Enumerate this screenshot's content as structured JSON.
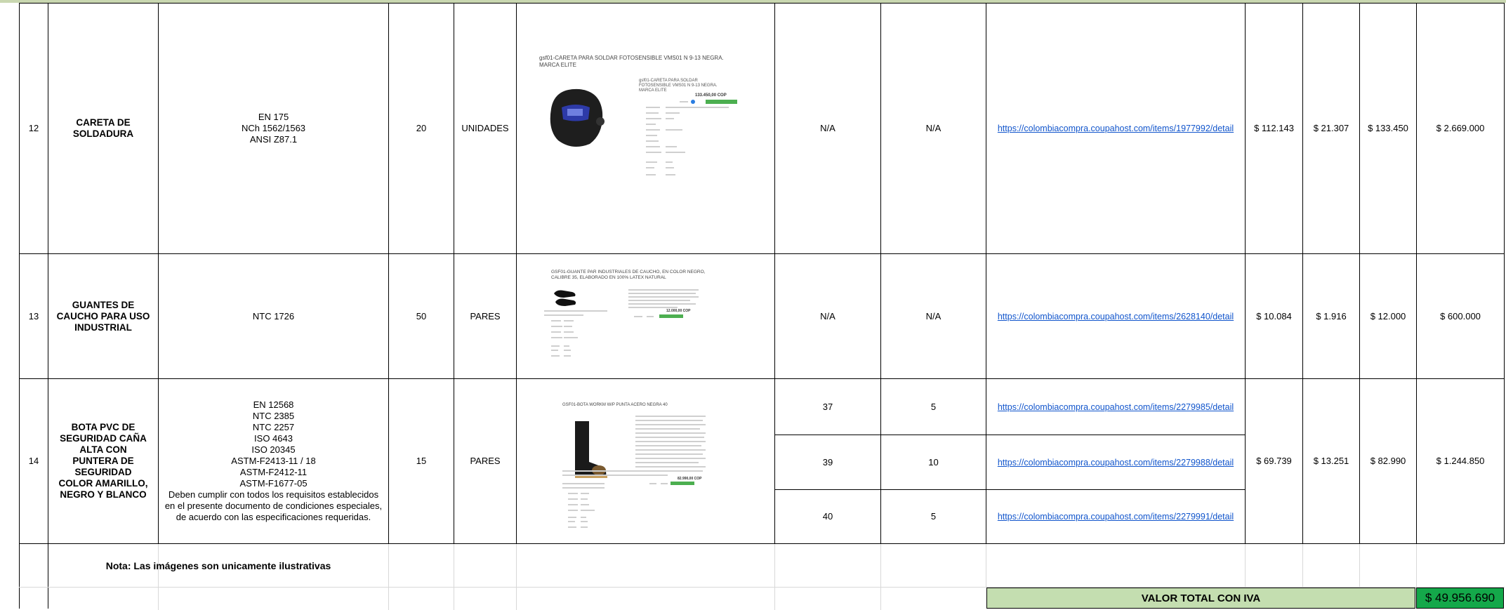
{
  "rows": [
    {
      "num": "12",
      "name": "CARETA DE SOLDADURA",
      "norms": [
        "EN 175",
        "NCh 1562/1563",
        "ANSI Z87.1"
      ],
      "qty": "20",
      "unit": "UNIDADES",
      "image": {
        "title": "gsf01-CARETA PARA SOLDAR FOTOSENSIBLE VMS01 N 9-13 NEGRA. MARCA ELITE",
        "side_title": "gsf01-CARETA PARA SOLDAR FOTOSENSIBLE VMS01 N 9-13 NEGRA. MARCA ELITE",
        "price": "133.450,00 COP",
        "button": "Agregar al carrito"
      },
      "sub": [
        {
          "size": "N/A",
          "count": "N/A",
          "link": "https://colombiacompra.coupahost.com/items/1977992/detail"
        }
      ],
      "unit_value": "$ 112.143",
      "iva": "$ 21.307",
      "unit_total": "$ 133.450",
      "total": "$ 2.669.000"
    },
    {
      "num": "13",
      "name": "GUANTES DE CAUCHO PARA USO INDUSTRIAL",
      "norms": [
        "NTC 1726"
      ],
      "qty": "50",
      "unit": "PARES",
      "image": {
        "title": "GSF01-GUANTE PAR INDUSTRIALES DE CAUCHO, EN COLOR NEGRO, CALIBRE 35, ELABORADO EN 100% LATEX NATURAL",
        "price": "12.000,00 COP",
        "button": "Agregar al carrito"
      },
      "sub": [
        {
          "size": "N/A",
          "count": "N/A",
          "link": "https://colombiacompra.coupahost.com/items/2628140/detail"
        }
      ],
      "unit_value": "$ 10.084",
      "iva": "$ 1.916",
      "unit_total": "$ 12.000",
      "total": "$ 600.000"
    },
    {
      "num": "14",
      "name": "BOTA PVC DE SEGURIDAD CAÑA ALTA CON PUNTERA DE SEGURIDAD COLOR AMARILLO, NEGRO Y BLANCO",
      "norms": [
        "EN 12568",
        "NTC 2385",
        "NTC 2257",
        "ISO 4643",
        "ISO 20345",
        "ASTM-F2413-11 / 18",
        "ASTM-F2412-11",
        "ASTM-F1677-05"
      ],
      "norms_note": "Deben cumplir con todos los requisitos establecidos en el presente documento de condiciones especiales, de acuerdo con las especificaciones requeridas.",
      "qty": "15",
      "unit": "PARES",
      "image": {
        "title": "GSF01-BOTA WORKM W/P PUNTA ACERO NEGRA 40",
        "price": "82.990,00 COP",
        "button": "Agregar al carrito"
      },
      "sub": [
        {
          "size": "37",
          "count": "5",
          "link": "https://colombiacompra.coupahost.com/items/2279985/detail"
        },
        {
          "size": "39",
          "count": "10",
          "link": "https://colombiacompra.coupahost.com/items/2279988/detail"
        },
        {
          "size": "40",
          "count": "5",
          "link": "https://colombiacompra.coupahost.com/items/2279991/detail"
        }
      ],
      "unit_value": "$ 69.739",
      "iva": "$ 13.251",
      "unit_total": "$ 82.990",
      "total": "$ 1.244.850"
    }
  ],
  "note": "Nota: Las imágenes son unicamente ilustrativas",
  "total_label": "VALOR TOTAL CON IVA",
  "total_value": "$ 49.956.690",
  "colors": {
    "total_label_bg": "#c4deb0",
    "total_value_bg": "#14a84a",
    "link": "#1155cc"
  },
  "icons": [
    "welding-helmet-image",
    "rubber-gloves-image",
    "pvc-boot-image"
  ]
}
